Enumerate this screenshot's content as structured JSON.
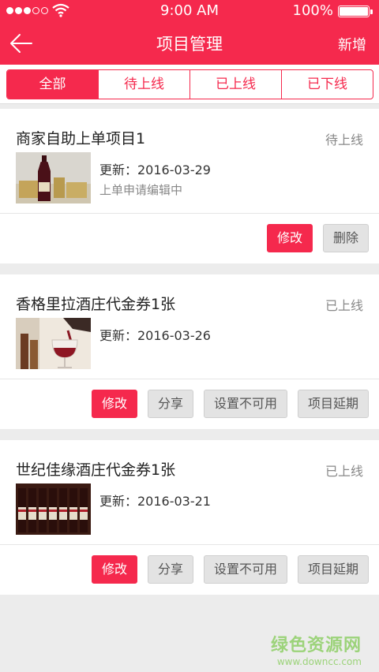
{
  "status_bar": {
    "time": "9:00 AM",
    "battery": "100%"
  },
  "nav": {
    "title": "项目管理",
    "add_label": "新增"
  },
  "tabs": [
    {
      "label": "全部",
      "active": true
    },
    {
      "label": "待上线",
      "active": false
    },
    {
      "label": "已上线",
      "active": false
    },
    {
      "label": "已下线",
      "active": false
    }
  ],
  "items": [
    {
      "name": "商家自助上单项目1",
      "status": "待上线",
      "updated": "更新：2016-03-29",
      "note": "上单申请编辑中",
      "thumb_icon": "wine-bottle-icon",
      "actions": [
        "修改",
        "删除"
      ]
    },
    {
      "name": "香格里拉酒庄代金券1张",
      "status": "已上线",
      "updated": "更新：2016-03-26",
      "note": "",
      "thumb_icon": "wine-glass-icon",
      "actions": [
        "修改",
        "分享",
        "设置不可用",
        "项目延期"
      ]
    },
    {
      "name": "世纪佳缘酒庄代金券1张",
      "status": "已上线",
      "updated": "更新：2016-03-21",
      "note": "",
      "thumb_icon": "wine-rack-icon",
      "actions": [
        "修改",
        "分享",
        "设置不可用",
        "项目延期"
      ]
    }
  ],
  "watermark": {
    "main": "绿色资源网",
    "sub": "www.downcc.com"
  },
  "colors": {
    "accent": "#f5294d",
    "background": "#ececec"
  }
}
